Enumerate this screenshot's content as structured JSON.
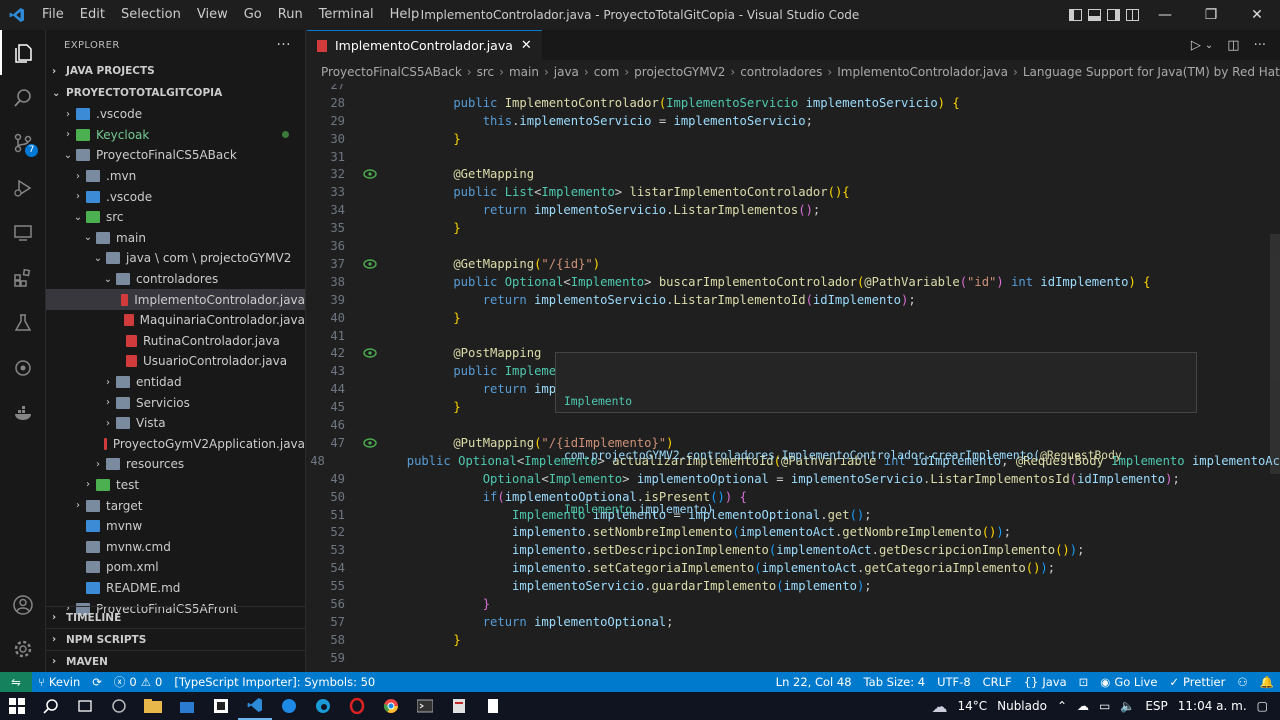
{
  "titlebar": {
    "menu": [
      "File",
      "Edit",
      "Selection",
      "View",
      "Go",
      "Run",
      "Terminal",
      "Help"
    ],
    "title": "ImplementoControlador.java - ProyectoTotalGitCopia - Visual Studio Code"
  },
  "sidebar": {
    "header": "EXPLORER",
    "more": "···",
    "java_projects": "JAVA PROJECTS",
    "workspace": "PROYECTOTOTALGITCOPIA",
    "tree": [
      {
        "label": ".vscode",
        "indent": 1,
        "arrow": "›",
        "kind": "folder-blue"
      },
      {
        "label": "Keycloak",
        "indent": 1,
        "arrow": "›",
        "kind": "folder-green",
        "green": true,
        "dot": true
      },
      {
        "label": "ProyectoFinalCS5ABack",
        "indent": 1,
        "arrow": "⌄",
        "kind": "folder"
      },
      {
        "label": ".mvn",
        "indent": 2,
        "arrow": "›",
        "kind": "folder"
      },
      {
        "label": ".vscode",
        "indent": 2,
        "arrow": "›",
        "kind": "folder-blue"
      },
      {
        "label": "src",
        "indent": 2,
        "arrow": "⌄",
        "kind": "folder-green"
      },
      {
        "label": "main",
        "indent": 3,
        "arrow": "⌄",
        "kind": "folder"
      },
      {
        "label": "java \\ com \\ projectoGYMV2",
        "indent": 4,
        "arrow": "⌄",
        "kind": "folder"
      },
      {
        "label": "controladores",
        "indent": 5,
        "arrow": "⌄",
        "kind": "folder"
      },
      {
        "label": "ImplementoControlador.java",
        "indent": 6,
        "arrow": "",
        "kind": "java",
        "selected": true
      },
      {
        "label": "MaquinariaControlador.java",
        "indent": 6,
        "arrow": "",
        "kind": "java"
      },
      {
        "label": "RutinaControlador.java",
        "indent": 6,
        "arrow": "",
        "kind": "java"
      },
      {
        "label": "UsuarioControlador.java",
        "indent": 6,
        "arrow": "",
        "kind": "java"
      },
      {
        "label": "entidad",
        "indent": 5,
        "arrow": "›",
        "kind": "folder"
      },
      {
        "label": "Servicios",
        "indent": 5,
        "arrow": "›",
        "kind": "folder"
      },
      {
        "label": "Vista",
        "indent": 5,
        "arrow": "›",
        "kind": "folder"
      },
      {
        "label": "ProyectoGymV2Application.java",
        "indent": 5,
        "arrow": "",
        "kind": "java"
      },
      {
        "label": "resources",
        "indent": 4,
        "arrow": "›",
        "kind": "folder"
      },
      {
        "label": "test",
        "indent": 3,
        "arrow": "›",
        "kind": "folder-green"
      },
      {
        "label": "target",
        "indent": 2,
        "arrow": "›",
        "kind": "folder"
      },
      {
        "label": "mvnw",
        "indent": 2,
        "arrow": "",
        "kind": "folder-blue"
      },
      {
        "label": "mvnw.cmd",
        "indent": 2,
        "arrow": "",
        "kind": "folder"
      },
      {
        "label": "pom.xml",
        "indent": 2,
        "arrow": "",
        "kind": "folder"
      },
      {
        "label": "README.md",
        "indent": 2,
        "arrow": "",
        "kind": "folder-blue"
      },
      {
        "label": "ProyectoFinalCS5AFront",
        "indent": 1,
        "arrow": "›",
        "kind": "folder"
      }
    ],
    "bottom_sections": [
      "TIMELINE",
      "NPM SCRIPTS",
      "MAVEN"
    ]
  },
  "editor": {
    "tab_label": "ImplementoControlador.java",
    "breadcrumbs": [
      "ProyectoFinalCS5ABack",
      "src",
      "main",
      "java",
      "com",
      "projectoGYMV2",
      "controladores",
      "ImplementoControlador.java",
      "Language Support for Java(TM) by Red Hat",
      "Imple"
    ],
    "first_line_number": 27,
    "lines": [
      {
        "n": "27",
        "parts": []
      },
      {
        "n": "28",
        "parts": [
          [
            "kw",
            "    public "
          ],
          [
            "fn",
            "ImplementoControlador"
          ],
          [
            "br1",
            "("
          ],
          [
            "ty",
            "ImplementoServicio "
          ],
          [
            "va",
            "implementoServicio"
          ],
          [
            "br1",
            ")"
          ],
          [
            "pu",
            " "
          ],
          [
            "br1",
            "{"
          ]
        ]
      },
      {
        "n": "29",
        "parts": [
          [
            "kw",
            "        this"
          ],
          [
            "pu",
            "."
          ],
          [
            "va",
            "implementoServicio"
          ],
          [
            "pu",
            " = "
          ],
          [
            "va",
            "implementoServicio"
          ],
          [
            "pu",
            ";"
          ]
        ]
      },
      {
        "n": "30",
        "parts": [
          [
            "br1",
            "    }"
          ]
        ]
      },
      {
        "n": "31",
        "parts": []
      },
      {
        "n": "32",
        "lens": true,
        "parts": [
          [
            "an",
            "    @GetMapping"
          ]
        ]
      },
      {
        "n": "33",
        "parts": [
          [
            "kw",
            "    public "
          ],
          [
            "ty",
            "List"
          ],
          [
            "pu",
            "<"
          ],
          [
            "ty",
            "Implemento"
          ],
          [
            "pu",
            "> "
          ],
          [
            "fn",
            "listarImplementoControlador"
          ],
          [
            "br1",
            "()"
          ],
          [
            "br1",
            "{"
          ]
        ]
      },
      {
        "n": "34",
        "parts": [
          [
            "kw",
            "        return "
          ],
          [
            "va",
            "implementoServicio"
          ],
          [
            "pu",
            "."
          ],
          [
            "fn",
            "ListarImplementos"
          ],
          [
            "br2",
            "()"
          ],
          [
            "pu",
            ";"
          ]
        ]
      },
      {
        "n": "35",
        "parts": [
          [
            "br1",
            "    }"
          ]
        ]
      },
      {
        "n": "36",
        "parts": []
      },
      {
        "n": "37",
        "lens": true,
        "parts": [
          [
            "an",
            "    @GetMapping"
          ],
          [
            "br1",
            "("
          ],
          [
            "st",
            "\"/{id}\""
          ],
          [
            "br1",
            ")"
          ]
        ]
      },
      {
        "n": "38",
        "parts": [
          [
            "kw",
            "    public "
          ],
          [
            "ty",
            "Optional"
          ],
          [
            "pu",
            "<"
          ],
          [
            "ty",
            "Implemento"
          ],
          [
            "pu",
            "> "
          ],
          [
            "fn",
            "buscarImplementoControlador"
          ],
          [
            "br1",
            "("
          ],
          [
            "an",
            "@PathVariable"
          ],
          [
            "br2",
            "("
          ],
          [
            "st",
            "\"id\""
          ],
          [
            "br2",
            ")"
          ],
          [
            "kw",
            " int "
          ],
          [
            "va",
            "idImplemento"
          ],
          [
            "br1",
            ")"
          ],
          [
            "pu",
            " "
          ],
          [
            "br1",
            "{"
          ]
        ]
      },
      {
        "n": "39",
        "parts": [
          [
            "kw",
            "        return "
          ],
          [
            "va",
            "implementoServicio"
          ],
          [
            "pu",
            "."
          ],
          [
            "fn",
            "ListarImplementoId"
          ],
          [
            "br2",
            "("
          ],
          [
            "va",
            "idImplemento"
          ],
          [
            "br2",
            ")"
          ],
          [
            "pu",
            ";"
          ]
        ]
      },
      {
        "n": "40",
        "parts": [
          [
            "br1",
            "    }"
          ]
        ]
      },
      {
        "n": "41",
        "parts": []
      },
      {
        "n": "42",
        "lens": true,
        "parts": [
          [
            "an",
            "    @PostMapping"
          ]
        ]
      },
      {
        "n": "43",
        "parts": [
          [
            "kw",
            "    public "
          ],
          [
            "ty",
            "Implemento "
          ],
          [
            "fn",
            "crearImplemento"
          ],
          [
            "br1",
            "("
          ],
          [
            "an",
            "@RequestBody "
          ],
          [
            "ty",
            "Implemento "
          ],
          [
            "va",
            "implemento"
          ],
          [
            "br1",
            ")"
          ],
          [
            "pu",
            " "
          ],
          [
            "br1",
            "{"
          ]
        ]
      },
      {
        "n": "44",
        "parts": [
          [
            "kw",
            "        return "
          ],
          [
            "va",
            "implementoServicio"
          ],
          [
            "pu",
            "."
          ],
          [
            "fn",
            "guardarImplemento"
          ],
          [
            "br2",
            "("
          ],
          [
            "va",
            "implemento"
          ],
          [
            "br2",
            ")"
          ],
          [
            "pu",
            ";"
          ]
        ]
      },
      {
        "n": "45",
        "parts": [
          [
            "br1",
            "    }"
          ]
        ]
      },
      {
        "n": "46",
        "parts": []
      },
      {
        "n": "47",
        "lens": true,
        "parts": [
          [
            "an",
            "    @PutMapping"
          ],
          [
            "br1",
            "("
          ],
          [
            "st",
            "\"/{idImplemento}\""
          ],
          [
            "br1",
            ")"
          ]
        ]
      },
      {
        "n": "48",
        "parts": [
          [
            "kw",
            "    public "
          ],
          [
            "ty",
            "Optional"
          ],
          [
            "pu",
            "<"
          ],
          [
            "ty",
            "Implemento"
          ],
          [
            "pu",
            "> "
          ],
          [
            "fn",
            "actualizarImplementoId"
          ],
          [
            "br1",
            "("
          ],
          [
            "an",
            "@PathVariable"
          ],
          [
            "kw",
            " int "
          ],
          [
            "va",
            "idImplemento"
          ],
          [
            "pu",
            ", "
          ],
          [
            "an",
            "@RequestBody "
          ],
          [
            "ty",
            "Implemento "
          ],
          [
            "va",
            "implementoAc"
          ]
        ]
      },
      {
        "n": "49",
        "parts": [
          [
            "ty",
            "        Optional"
          ],
          [
            "pu",
            "<"
          ],
          [
            "ty",
            "Implemento"
          ],
          [
            "pu",
            "> "
          ],
          [
            "va",
            "implementoOptional"
          ],
          [
            "pu",
            " = "
          ],
          [
            "va",
            "implementoServicio"
          ],
          [
            "pu",
            "."
          ],
          [
            "fn",
            "ListarImplementosId"
          ],
          [
            "br2",
            "("
          ],
          [
            "va",
            "idImplemento"
          ],
          [
            "br2",
            ")"
          ],
          [
            "pu",
            ";"
          ]
        ]
      },
      {
        "n": "50",
        "parts": [
          [
            "kw",
            "        if"
          ],
          [
            "br2",
            "("
          ],
          [
            "va",
            "implementoOptional"
          ],
          [
            "pu",
            "."
          ],
          [
            "fn",
            "isPresent"
          ],
          [
            "br3",
            "()"
          ],
          [
            "br2",
            ")"
          ],
          [
            "pu",
            " "
          ],
          [
            "br2",
            "{"
          ]
        ]
      },
      {
        "n": "51",
        "parts": [
          [
            "ty",
            "            Implemento "
          ],
          [
            "va",
            "implemento"
          ],
          [
            "pu",
            " = "
          ],
          [
            "va",
            "implementoOptional"
          ],
          [
            "pu",
            "."
          ],
          [
            "fn",
            "get"
          ],
          [
            "br3",
            "()"
          ],
          [
            "pu",
            ";"
          ]
        ]
      },
      {
        "n": "52",
        "parts": [
          [
            "va",
            "            implemento"
          ],
          [
            "pu",
            "."
          ],
          [
            "fn",
            "setNombreImplemento"
          ],
          [
            "br3",
            "("
          ],
          [
            "va",
            "implementoAct"
          ],
          [
            "pu",
            "."
          ],
          [
            "fn",
            "getNombreImplemento"
          ],
          [
            "br1",
            "()"
          ],
          [
            "br3",
            ")"
          ],
          [
            "pu",
            ";"
          ]
        ]
      },
      {
        "n": "53",
        "parts": [
          [
            "va",
            "            implemento"
          ],
          [
            "pu",
            "."
          ],
          [
            "fn",
            "setDescripcionImplemento"
          ],
          [
            "br3",
            "("
          ],
          [
            "va",
            "implementoAct"
          ],
          [
            "pu",
            "."
          ],
          [
            "fn",
            "getDescripcionImplemento"
          ],
          [
            "br1",
            "()"
          ],
          [
            "br3",
            ")"
          ],
          [
            "pu",
            ";"
          ]
        ]
      },
      {
        "n": "54",
        "parts": [
          [
            "va",
            "            implemento"
          ],
          [
            "pu",
            "."
          ],
          [
            "fn",
            "setCategoriaImplemento"
          ],
          [
            "br3",
            "("
          ],
          [
            "va",
            "implementoAct"
          ],
          [
            "pu",
            "."
          ],
          [
            "fn",
            "getCategoriaImplemento"
          ],
          [
            "br1",
            "()"
          ],
          [
            "br3",
            ")"
          ],
          [
            "pu",
            ";"
          ]
        ]
      },
      {
        "n": "55",
        "parts": [
          [
            "va",
            "            implementoServicio"
          ],
          [
            "pu",
            "."
          ],
          [
            "fn",
            "guardarImplemento"
          ],
          [
            "br3",
            "("
          ],
          [
            "va",
            "implemento"
          ],
          [
            "br3",
            ")"
          ],
          [
            "pu",
            ";"
          ]
        ]
      },
      {
        "n": "56",
        "parts": [
          [
            "br2",
            "        }"
          ]
        ]
      },
      {
        "n": "57",
        "parts": [
          [
            "kw",
            "        return "
          ],
          [
            "va",
            "implementoOptional"
          ],
          [
            "pu",
            ";"
          ]
        ]
      },
      {
        "n": "58",
        "parts": [
          [
            "br1",
            "    }"
          ]
        ]
      },
      {
        "n": "59",
        "parts": []
      }
    ],
    "hover": {
      "line1": "Implemento",
      "line2_pre": "com.projectoGYMV2.controladores.ImplementoControlador.crearImplemento(",
      "line2_ann": "@RequestBody",
      "line3_type": "Implemento",
      "line3_rest": " implemento)"
    }
  },
  "statusbar": {
    "branch": "Kevin",
    "errors": "0",
    "warnings": "0",
    "ts_importer": "[TypeScript Importer]: Symbols: 50",
    "position": "Ln 22, Col 48",
    "tab_size": "Tab Size: 4",
    "encoding": "UTF-8",
    "eol": "CRLF",
    "language": "Java",
    "go_live": "Go Live",
    "prettier": "Prettier"
  },
  "taskbar": {
    "weather_temp": "14°C",
    "weather_desc": "Nublado",
    "lang": "ESP",
    "time": "11:04 a. m."
  },
  "colors": {
    "statusbar": "#007acc",
    "accent": "#0078d4"
  }
}
